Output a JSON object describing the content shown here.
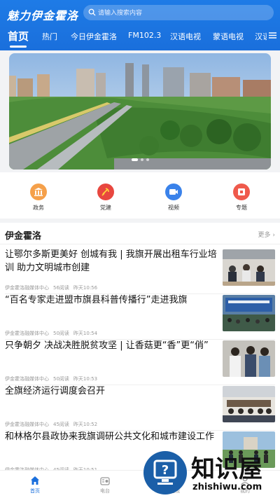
{
  "header": {
    "app_title": "魅力伊金霍洛",
    "search_placeholder": "请输入搜索内容"
  },
  "tabs": [
    "首页",
    "热门",
    "今日伊金霍洛",
    "FM102.3",
    "汉语电视",
    "蒙语电视",
    "汉语"
  ],
  "quick_links": [
    {
      "label": "政务",
      "icon": "government-icon",
      "color": "#f5a04a"
    },
    {
      "label": "党建",
      "icon": "party-icon",
      "color": "#e8473f"
    },
    {
      "label": "视频",
      "icon": "video-icon",
      "color": "#3a82ea"
    },
    {
      "label": "专题",
      "icon": "topic-icon",
      "color": "#ef5a4c"
    }
  ],
  "section": {
    "title": "伊金霍洛",
    "more": "更多"
  },
  "news": [
    {
      "title": "让鄂尔多斯更美好 创城有我 | 我旗开展出租车行业培训 助力文明城市创建",
      "source": "伊金霍洛融媒体中心",
      "reads": "56阅读",
      "time": "昨天10:56"
    },
    {
      "title": "“百名专家走进盟市旗县科普传播行”走进我旗",
      "source": "伊金霍洛融媒体中心",
      "reads": "50阅读",
      "time": "昨天10:54"
    },
    {
      "title": "只争朝夕 决战决胜脱贫攻坚 | 让香菇更“香”更“俏”",
      "source": "伊金霍洛融媒体中心",
      "reads": "50阅读",
      "time": "昨天10:53"
    },
    {
      "title": "全旗经济运行调度会召开",
      "source": "伊金霍洛融媒体中心",
      "reads": "45阅读",
      "time": "昨天10:52"
    },
    {
      "title": "和林格尔县政协来我旗调研公共文化和城市建设工作",
      "source": "伊金霍洛融媒体中心",
      "reads": "45阅读",
      "time": "昨天10:51"
    }
  ],
  "bottom_nav": [
    "首页",
    "电台",
    "电视",
    "我的"
  ],
  "watermark": {
    "text": "知识屋",
    "sub": "zhishiwu.com"
  },
  "colors": {
    "brand": "#1a6fdc",
    "background": "#f2f3f5"
  }
}
